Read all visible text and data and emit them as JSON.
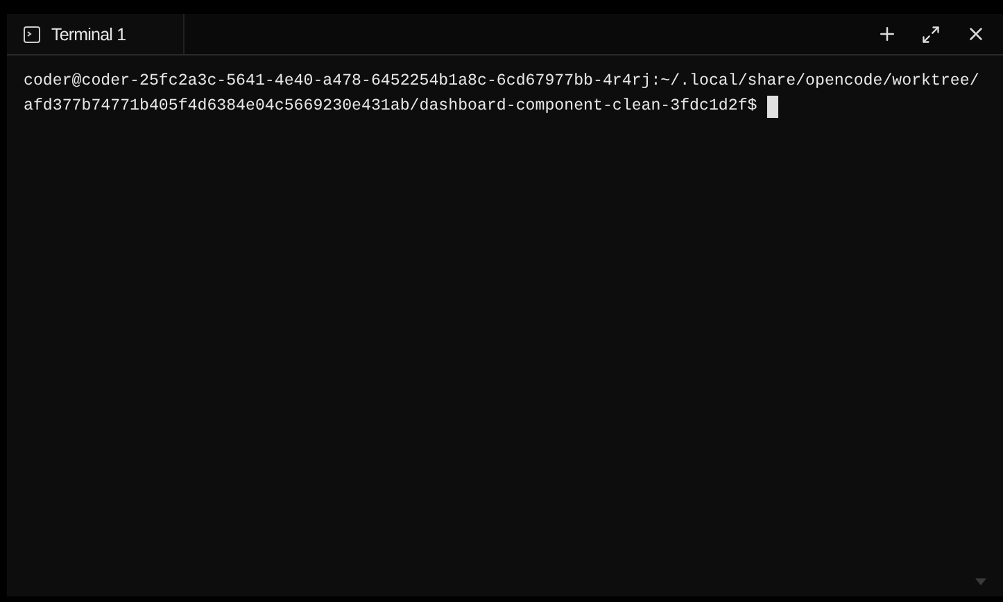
{
  "tabs": [
    {
      "label": "Terminal 1",
      "selected": true
    }
  ],
  "terminal": {
    "lines": [
      "coder@coder-25fc2a3c-5641-4e40-a478-6452254b1a8c-6cd67977bb-4r4rj:~/.local/share/opencode/worktree/",
      "afd377b74771b405f4d6384e04c5669230e431ab/dashboard-component-clean-3fdc1d2f$"
    ],
    "cursor": true
  }
}
